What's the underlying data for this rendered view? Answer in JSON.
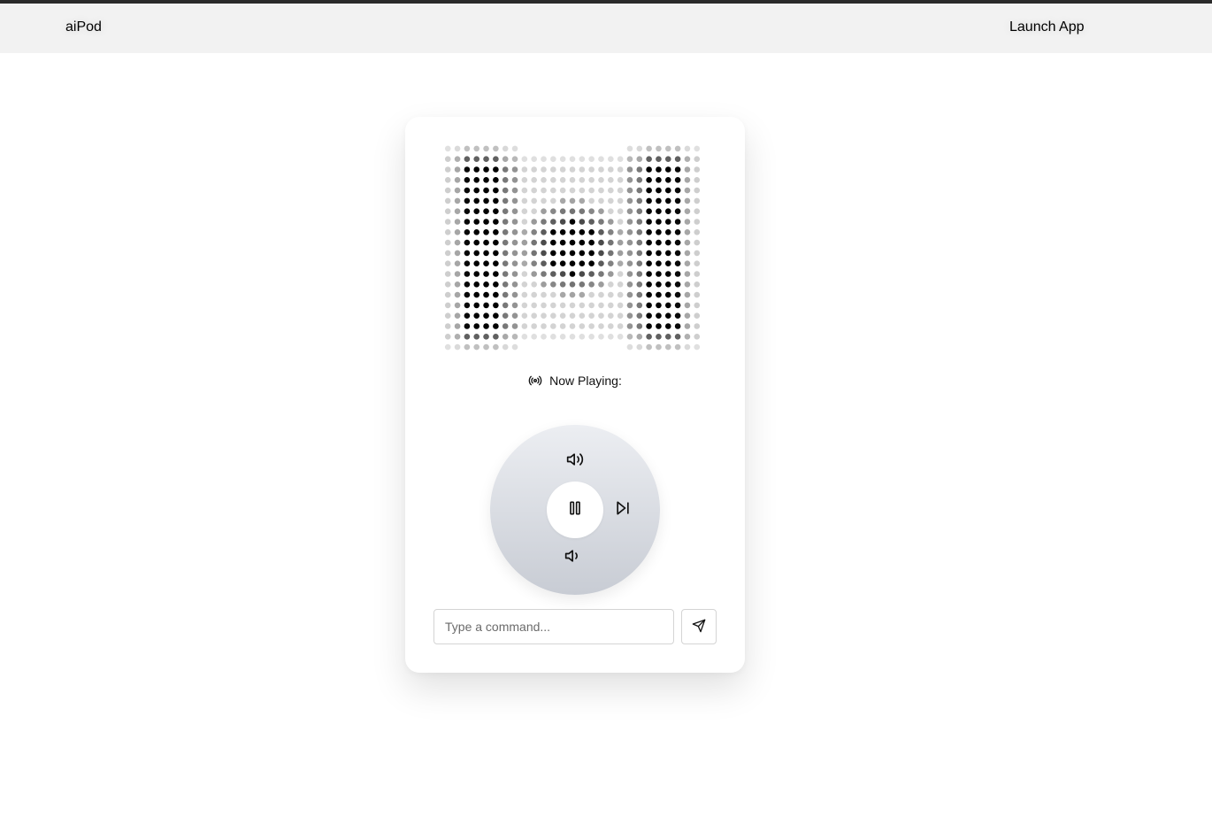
{
  "nav": {
    "brand": "aiPod",
    "launch_label": "Launch App"
  },
  "player": {
    "now_playing_label": "Now Playing:",
    "icons": {
      "now_playing": "radio-broadcast-icon",
      "volume_up": "volume-up-icon",
      "volume_down": "volume-down-icon",
      "play_pause": "pause-icon",
      "next": "skip-forward-icon",
      "send": "send-icon"
    }
  },
  "command": {
    "placeholder": "Type a command...",
    "value": ""
  },
  "colors": {
    "nav_background": "#f2f2f2",
    "top_strip": "#2a2a2a",
    "wheel_top": "#eceef2",
    "wheel_bottom": "#c8ccd4",
    "dot_color": "#000000"
  }
}
